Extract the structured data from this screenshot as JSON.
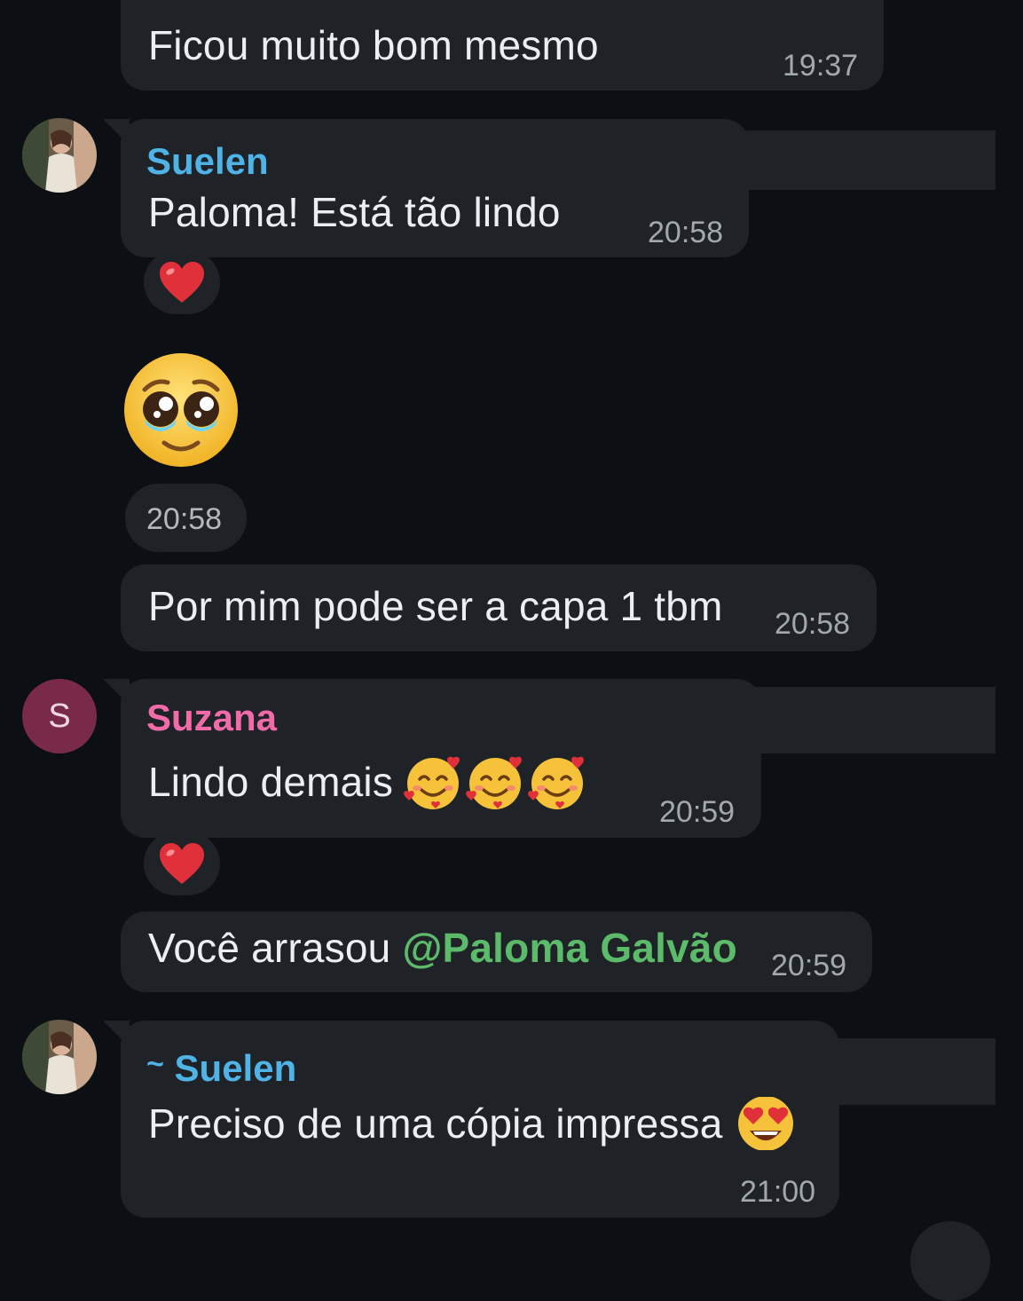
{
  "colors": {
    "background": "#0c0f14",
    "bubble": "#1f2227",
    "suelen_name": "#4fb3e6",
    "suzana_name": "#f06ba8",
    "mention": "#5cbb6a",
    "heart": "#e0303a",
    "avatar_s": "#7a2a49"
  },
  "messages": [
    {
      "text": "Ficou muito bom mesmo",
      "time": "19:37"
    },
    {
      "sender": "Suelen",
      "avatar": "photo",
      "text": "Paloma! Está tão lindo",
      "time": "20:58",
      "reaction": "red-heart"
    },
    {
      "emoji": "pleading-face",
      "time": "20:58"
    },
    {
      "text": "Por mim pode ser a capa 1 tbm",
      "time": "20:58"
    },
    {
      "sender": "Suzana",
      "avatar_letter": "S",
      "text": "Lindo demais",
      "emoji_count": 3,
      "time": "20:59",
      "reaction": "red-heart"
    },
    {
      "text_prefix": "Você arrasou",
      "mention": "@Paloma Galvão",
      "time": "20:59"
    },
    {
      "sender_prefix": "~",
      "sender": "Suelen",
      "avatar": "photo",
      "text": "Preciso de uma cópia impressa",
      "time": "21:00"
    }
  ]
}
